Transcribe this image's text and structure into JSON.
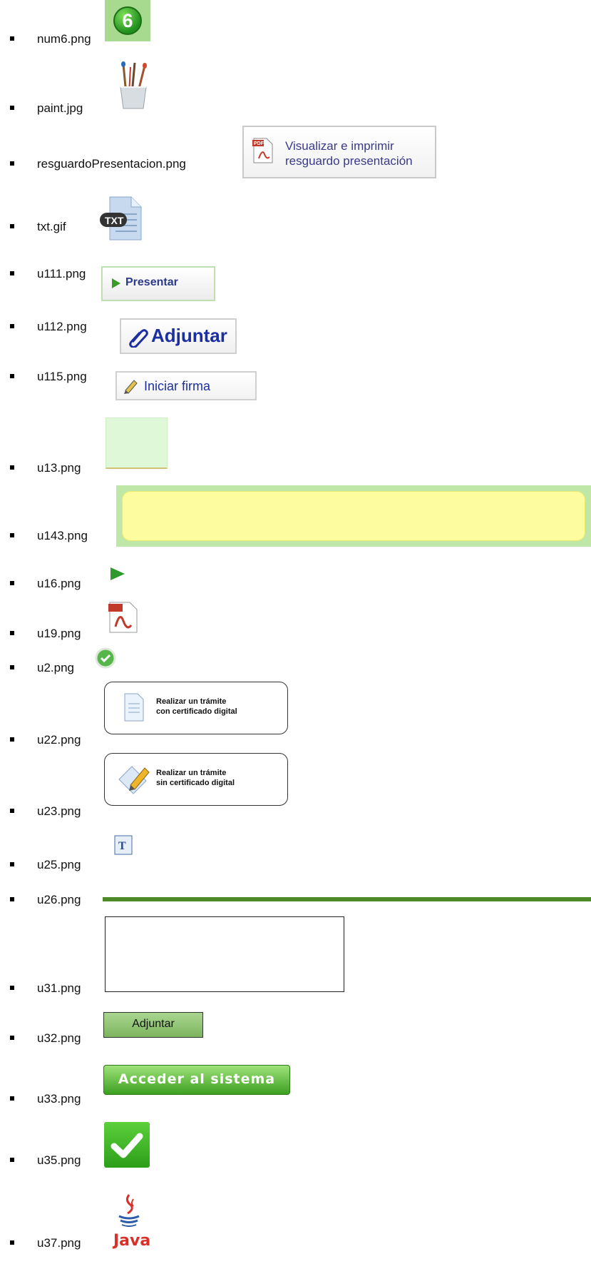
{
  "items": [
    {
      "label": "num6.png",
      "image_text": "6"
    },
    {
      "label": "paint.jpg"
    },
    {
      "label": "resguardoPresentacion.png",
      "image_text_line1": "Visualizar e imprimir",
      "image_text_line2": "resguardo presentación"
    },
    {
      "label": "txt.gif",
      "image_text": "TXT"
    },
    {
      "label": "u111.png",
      "image_text": "Presentar"
    },
    {
      "label": "u112.png",
      "image_text": "Adjuntar"
    },
    {
      "label": "u115.png",
      "image_text": "Iniciar firma"
    },
    {
      "label": "u13.png"
    },
    {
      "label": "u143.png"
    },
    {
      "label": "u16.png"
    },
    {
      "label": "u19.png"
    },
    {
      "label": "u2.png"
    },
    {
      "label": "u22.png",
      "image_text_line1": "Realizar un trámite",
      "image_text_line2": "con certificado digital"
    },
    {
      "label": "u23.png",
      "image_text_line1": "Realizar un trámite",
      "image_text_line2": "sin certificado digital"
    },
    {
      "label": "u25.png"
    },
    {
      "label": "u26.png"
    },
    {
      "label": "u31.png"
    },
    {
      "label": "u32.png",
      "image_text": "Adjuntar"
    },
    {
      "label": "u33.png",
      "image_text": "Acceder al sistema"
    },
    {
      "label": "u35.png"
    },
    {
      "label": "u37.png",
      "image_text": "Java"
    }
  ],
  "colors": {
    "accent_green": "#4e8a28",
    "link_blue": "#1c2fa0"
  }
}
